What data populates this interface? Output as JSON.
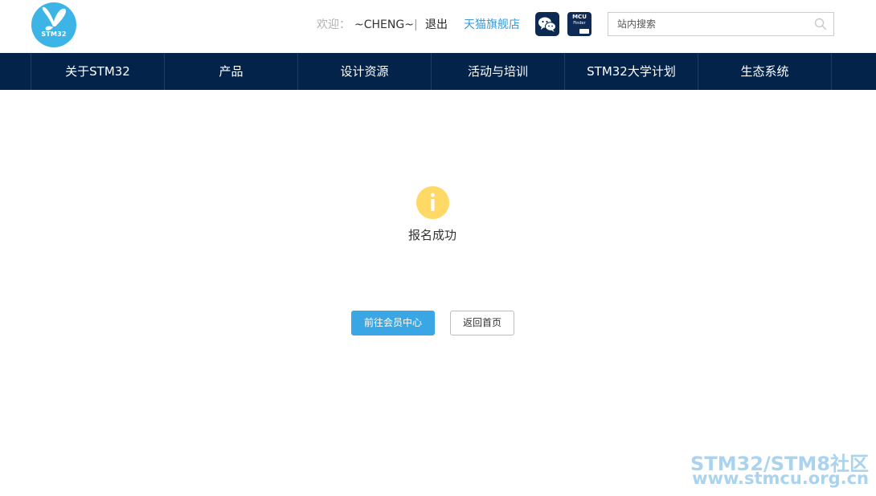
{
  "header": {
    "logo_text": "STM32",
    "welcome_label": "欢迎：",
    "username": "~CHENG~",
    "separator": "|",
    "logout_label": "退出",
    "tmall_label": "天猫旗舰店",
    "mcu_button": {
      "line1": "MCU",
      "line2": "Finder"
    },
    "search": {
      "placeholder": "站内搜索",
      "value": ""
    }
  },
  "nav": {
    "items": [
      {
        "label": "关于STM32"
      },
      {
        "label": "产品"
      },
      {
        "label": "设计资源"
      },
      {
        "label": "活动与培训"
      },
      {
        "label": "STM32大学计划"
      },
      {
        "label": "生态系统"
      }
    ]
  },
  "main": {
    "message": "报名成功",
    "primary_button": "前往会员中心",
    "secondary_button": "返回首页"
  },
  "watermark": {
    "line1": "STM32/STM8社区",
    "line2": "www.stmcu.org.cn"
  },
  "colors": {
    "nav_bg": "#03234b",
    "accent": "#3aa7e4",
    "logo": "#3cb4e5",
    "info_icon": "#fed966",
    "link": "#3a9bd9"
  },
  "icons": {
    "logo": "butterfly-logo-icon",
    "wechat": "wechat-icon",
    "mcu": "mcu-finder-icon",
    "search": "search-icon",
    "info": "info-icon"
  }
}
